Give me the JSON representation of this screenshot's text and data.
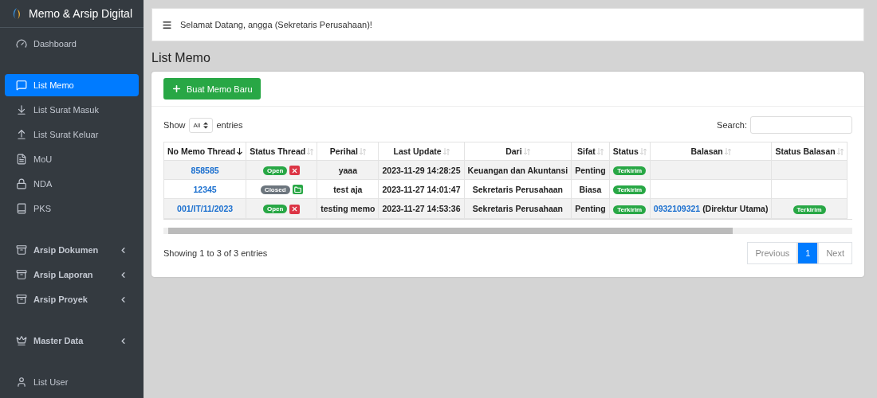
{
  "brand": {
    "title": "Memo & Arsip Digital"
  },
  "sidebar": {
    "groups": [
      {
        "items": [
          {
            "label": "Dashboard",
            "selected": false,
            "expandable": false
          }
        ]
      },
      {
        "items": [
          {
            "label": "List Memo",
            "selected": true,
            "expandable": false
          },
          {
            "label": "List Surat Masuk",
            "selected": false,
            "expandable": false
          },
          {
            "label": "List Surat Keluar",
            "selected": false,
            "expandable": false
          },
          {
            "label": "MoU",
            "selected": false,
            "expandable": false
          },
          {
            "label": "NDA",
            "selected": false,
            "expandable": false
          },
          {
            "label": "PKS",
            "selected": false,
            "expandable": false
          }
        ]
      },
      {
        "items": [
          {
            "label": "Arsip Dokumen",
            "selected": false,
            "expandable": true
          },
          {
            "label": "Arsip Laporan",
            "selected": false,
            "expandable": true
          },
          {
            "label": "Arsip Proyek",
            "selected": false,
            "expandable": true
          }
        ]
      },
      {
        "items": [
          {
            "label": "Master Data",
            "selected": false,
            "expandable": true
          }
        ]
      },
      {
        "items": [
          {
            "label": "List User",
            "selected": false,
            "expandable": false
          }
        ]
      }
    ]
  },
  "topbar": {
    "greeting": "Selamat Datang, angga (Sekretaris Perusahaan)!"
  },
  "page_title": "List Memo",
  "new_button": "Buat Memo Baru",
  "length_control": {
    "before": "Show",
    "value": "All",
    "after": "entries"
  },
  "search": {
    "label": "Search:"
  },
  "table": {
    "columns": [
      {
        "label": "No Memo Thread",
        "sorted": true
      },
      {
        "label": "Status Thread",
        "sorted": false
      },
      {
        "label": "Perihal",
        "sorted": false
      },
      {
        "label": "Last Update",
        "sorted": false
      },
      {
        "label": "Dari",
        "sorted": false
      },
      {
        "label": "Sifat",
        "sorted": false
      },
      {
        "label": "Status",
        "sorted": false
      },
      {
        "label": "Balasan",
        "sorted": false
      },
      {
        "label": "Status Balasan",
        "sorted": false
      }
    ],
    "rows": [
      {
        "no": "858585",
        "thread_status": {
          "label": "Open",
          "kind": "open"
        },
        "perihal": "yaaa",
        "last_update": "2023-11-29 14:28:25",
        "dari": "Keuangan dan Akuntansi",
        "sifat": "Penting",
        "status": "Terkirim"
      },
      {
        "no": "12345",
        "thread_status": {
          "label": "Closed",
          "kind": "closed"
        },
        "perihal": "test aja",
        "last_update": "2023-11-27 14:01:47",
        "dari": "Sekretaris Perusahaan",
        "sifat": "Biasa",
        "status": "Terkirim"
      },
      {
        "no": "001/IT/11/2023",
        "thread_status": {
          "label": "Open",
          "kind": "open"
        },
        "perihal": "testing memo",
        "last_update": "2023-11-27 14:53:36",
        "dari": "Sekretaris Perusahaan",
        "sifat": "Penting",
        "status": "Terkirim",
        "balasan": {
          "link": "0932109321",
          "rest": "(Direktur Utama)"
        },
        "status_balasan": "Terkirim"
      }
    ]
  },
  "info": "Showing 1 to 3 of 3 entries",
  "pagination": [
    {
      "label": "Previous",
      "selected": false,
      "disabled": true
    },
    {
      "label": "1",
      "selected": true,
      "disabled": false
    },
    {
      "label": "Next",
      "selected": false,
      "disabled": true
    }
  ]
}
